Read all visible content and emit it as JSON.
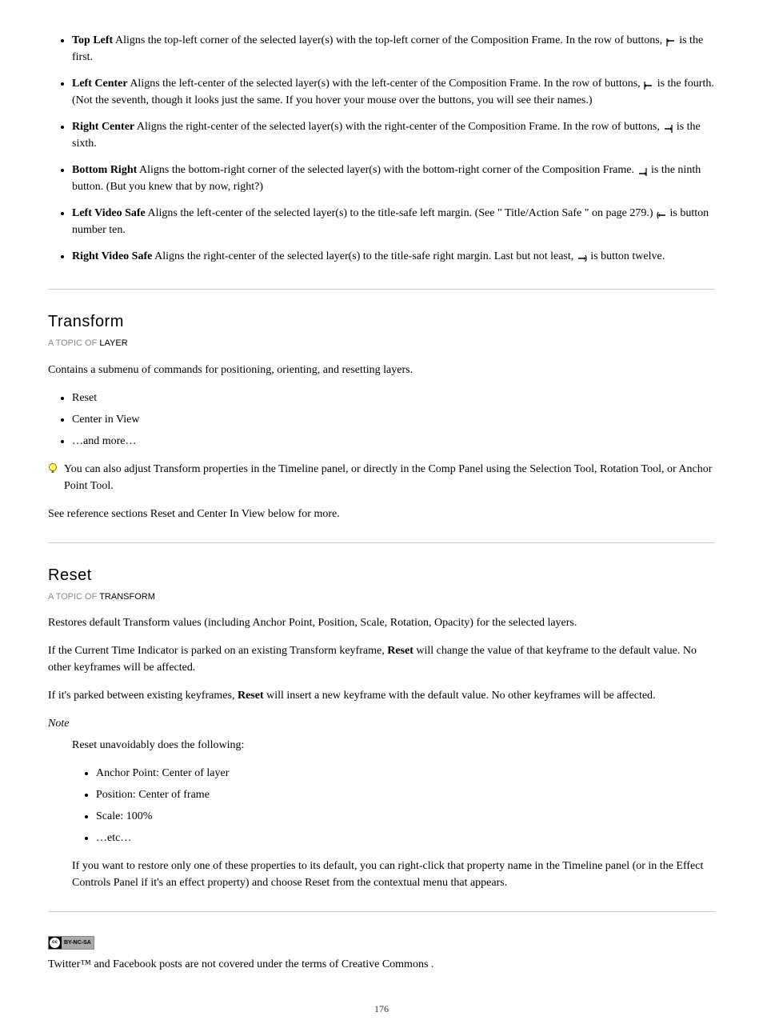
{
  "anchors": {
    "items": [
      {
        "primary": "Top Left",
        "text_after_primary": "Aligns the top-left corner of the selected layer(s) with the top-left corner of the Composition Frame. In the row of buttons, ",
        "icon_name": "top-left-icon",
        "text_after_icon": " is the first."
      },
      {
        "primary": "Left Center",
        "text_after_primary": "Aligns the left-center of the selected layer(s) with the left-center of the Composition Frame. In the row of buttons, ",
        "icon_name": "left-center-icon",
        "text_after_icon": " is the fourth. (Not the seventh, though it looks just the same. If you hover your mouse over the buttons, you will see their names.)"
      },
      {
        "primary": "Right Center",
        "text_after_primary": "Aligns the right-center of the selected layer(s) with the right-center of the Composition Frame. In the row of buttons, ",
        "icon_name": "right-center-icon",
        "text_after_icon": " is the sixth."
      },
      {
        "primary": "Bottom Right",
        "text_after_primary": "Aligns the bottom-right corner of the selected layer(s) with the bottom-right corner of the Composition Frame. ",
        "icon_name": "bottom-right-icon",
        "text_after_icon": " is the ninth button. (But you knew that by now, right?)"
      },
      {
        "primary": "Left Video Safe",
        "text_after_primary": "Aligns the left-center of the selected layer(s) to the title-safe left margin. (See \"",
        "link_text": "Title/Action Safe",
        "text_after_link": "\" on page 279.) ",
        "icon_name": "left-video-safe-icon",
        "text_after_icon": " is button number ten."
      },
      {
        "primary": "Right Video Safe",
        "text_after_primary": "Aligns the right-center of the selected layer(s) to the title-safe right margin. Last but not least, ",
        "icon_name": "right-video-safe-icon",
        "text_after_icon": " is button twelve."
      }
    ]
  },
  "section_transform": {
    "heading": "Transform",
    "topicof_label": "A TOPIC OF",
    "topicof_link": "LAYER",
    "intro": "Contains a submenu of commands for positioning, orienting, and resetting layers.",
    "sub_items": [
      "Reset",
      "Center in View",
      "…and more…"
    ],
    "tip_text": "You can also adjust Transform properties in the Timeline panel, or directly in the Comp Panel using the Selection Tool, Rotation Tool, or Anchor Point Tool.",
    "ref_prefix": "See reference sections ",
    "ref_links": [
      "Reset",
      "Center In View"
    ],
    "ref_mid": " and ",
    "ref_suffix": " below for more."
  },
  "section_reset": {
    "heading": "Reset",
    "topicof_label": "A TOPIC OF",
    "topicof_link": "TRANSFORM",
    "para1": "Restores default Transform values (including Anchor Point, Position, Scale, Rotation, Opacity) for the selected layers.",
    "para2_prefix": "If the Current Time Indicator is parked on an existing Transform keyframe, ",
    "para2_strong": "Reset",
    "para2_suffix": " will change the value of that keyframe to the default value. No other keyframes will be affected.",
    "para3_prefix": "If it's parked between existing keyframes, ",
    "para3_strong": "Reset",
    "para3_suffix": " will insert a new keyframe with the default value. No other keyframes will be affected.",
    "note_label": "Note",
    "note_intro": "Reset unavoidably does the following:",
    "note_items": [
      "Anchor Point: Center of layer",
      "Position: Center of frame",
      "Scale: 100%",
      "…etc…"
    ],
    "note_para2": "If you want to restore only one of these properties to its default, you can right-click that property name in the Timeline panel (or in the Effect Controls Panel if it's an effect property) and choose Reset from the contextual menu that appears."
  },
  "footer": {
    "badge_text": "BY-NC-SA",
    "legal_prefix": "Twitter™ and Facebook posts are not covered under the terms of ",
    "legal_link": "Creative Commons",
    "legal_suffix": ".",
    "page_number": "176"
  }
}
